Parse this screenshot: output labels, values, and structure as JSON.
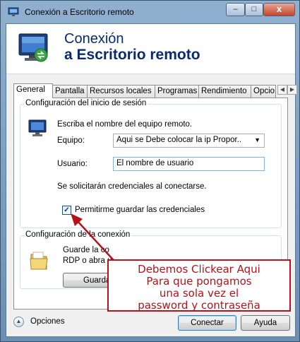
{
  "window": {
    "title": "Conexión a Escritorio remoto",
    "buttons": {
      "minimize": "–",
      "maximize": "□",
      "close": "x"
    }
  },
  "header": {
    "line1": "Conexión",
    "line2": "a Escritorio remoto"
  },
  "tabs": [
    {
      "label": "General",
      "active": true
    },
    {
      "label": "Pantalla",
      "active": false
    },
    {
      "label": "Recursos locales",
      "active": false
    },
    {
      "label": "Programas",
      "active": false
    },
    {
      "label": "Rendimiento",
      "active": false
    },
    {
      "label": "Opcio",
      "active": false
    }
  ],
  "tab_scroll": {
    "left": "◀",
    "right": "▶"
  },
  "login_group": {
    "title": "Configuración del inicio de sesión",
    "instruction": "Escriba el nombre del equipo remoto.",
    "equipo_label": "Equipo:",
    "equipo_value": "Aqui se Debe colocar la ip Propor..",
    "usuario_label": "Usuario:",
    "usuario_value": "El nombre de usuario",
    "credentials_note": "Se solicitarán credenciales al conectarse.",
    "save_credentials_label": "Permitirme guardar las credenciales",
    "save_credentials_checked": true
  },
  "connection_group": {
    "title": "Configuración de la conexión",
    "line1": "Guarde la co",
    "line2": "RDP o abra u",
    "save_button": "Guarda"
  },
  "footer": {
    "options_label": "Opciones",
    "connect_button": "Conectar",
    "help_button": "Ayuda"
  },
  "annotation": {
    "lines": [
      "Debemos Clickear Aqui",
      "Para que pongamos",
      "una sola vez el",
      "password y contraseña"
    ],
    "color": "#b5121b"
  },
  "colors": {
    "title_blue": "#0a2a6e",
    "accent_red": "#b5121b"
  }
}
